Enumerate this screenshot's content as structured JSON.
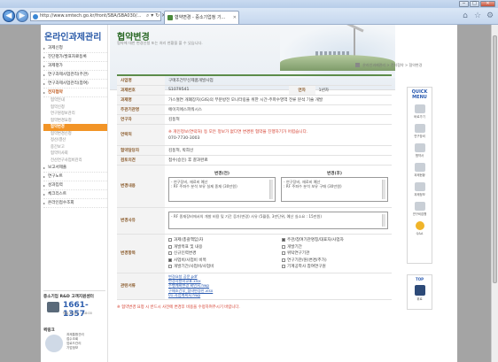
{
  "browser": {
    "address": "http://www.smtech.go.kr/front/SBA/SBA030/...",
    "tab_title": "협약변경 - 중소기업청 기...",
    "window_buttons": [
      "─",
      "□",
      "✕"
    ]
  },
  "sidebar": {
    "title": "온라인과제관리",
    "items": [
      {
        "label": "과제신청"
      },
      {
        "label": "진단평가/발표자료등록"
      },
      {
        "label": "과제평가"
      },
      {
        "label": "연구과제사업관리(주관)"
      },
      {
        "label": "연구과제사업관리(참여)"
      },
      {
        "label": "전자협약"
      }
    ],
    "sub_items": [
      "협약안내",
      "협약신청",
      "연구원정보관리",
      "협약변경요청",
      "협약변경",
      "협약변경신청",
      "정산/결산",
      "중간보고",
      "협약이사회",
      "전산연구사업비관리"
    ],
    "items_after": [
      {
        "label": "보고서제출"
      },
      {
        "label": "연구노트"
      },
      {
        "label": "성과입력"
      },
      {
        "label": "체크리스트"
      },
      {
        "label": "온라인접수조회"
      }
    ],
    "contact_head": "중소기업 R&D 고객지원센터",
    "contact_number": "1661-1357",
    "contact_hours": "평일 09:00 ~ 18:00",
    "links_head": "퀵링크",
    "links": [
      "과제통합관리",
      "접수조회",
      "업로드관리",
      "기업정보"
    ]
  },
  "header": {
    "title": "협약변경",
    "description": "협약에 대한 변경신청 또는 처리 현황을 볼 수 있습니다.",
    "breadcrumb": "온라인과제관리 > 전자협약 > 협약변경"
  },
  "form": {
    "project_name_label": "사업명",
    "project_name": "구매조건부신제품개발사업",
    "project_no_label": "과제번호",
    "project_no": "S1079541",
    "year_label": "연차",
    "year": "1년차",
    "task_name_label": "과제명",
    "task_name": "가스절연 개폐장치(GIS)의 부분방전 모니터링을 위한 시간-주파수영역 전류 분석 기술 개발",
    "lead_org_label": "주관기관명",
    "lead_org": "에이치에스파워시스",
    "researcher_label": "연구자",
    "researcher": "김동혁",
    "contact_label": "연락처",
    "contact_note": "※ 개인정보(연락처) 등 모든 정보가 없다면 변경된 협약을 진행하기가 어렵습니다.",
    "contact_phone": "070-7730-3003",
    "manager_label": "협약담당자",
    "manager": "김동혁, 박희선",
    "review_label": "검토의견",
    "review": "접수(승인) 후 결과완료",
    "change_content_label": "변경내용",
    "before_label": "변경(전)",
    "after_label": "변경(후)",
    "before_text": "- 연구장비, 재료비 예산\n: RF 주파수 분석 보유 실제 종재 (30만원)",
    "after_text": "- 연구장비, 재료비 예산\n: RF 주파수 분석 보유 구매 (30만원)",
    "reason_label": "변경사유",
    "reason_text": "- RF 종재장비에서의 개발 비용 및 기간 증가(변경) 사유 (5월중, 3만단위, 예산 실소요 : 15만원)",
    "items_label": "변경항목",
    "items": [
      {
        "label": "과제(총괄책임)자",
        "checked": false
      },
      {
        "label": "주관/참여기관명칭/대표자/사업자",
        "checked": true
      },
      {
        "label": "개발목표 및 내용",
        "checked": false
      },
      {
        "label": "개발기간",
        "checked": false
      },
      {
        "label": "신규인력변경",
        "checked": false
      },
      {
        "label": "위탁연구기관",
        "checked": false
      },
      {
        "label": "사업비/사업비 비목",
        "checked": true
      },
      {
        "label": "연구기관/원(변경/추가)",
        "checked": false
      },
      {
        "label": "개발기간/사업비/사업비",
        "checked": false
      },
      {
        "label": "기계공학사 참여연구원",
        "checked": false
      }
    ],
    "attach_label": "관련서류",
    "attachments": [
      "변경요청 공문.pdf",
      "변경사항비교표.xlsx",
      "수행계획변경 확인서.hwp",
      "구매조건부_협약변경안.xlsx",
      "01-사업계획서.hwp"
    ],
    "footnote": "※ 협약변경 요청 시 반드시 사전에 변경후 비용을 수정하여주시기 바랍니다."
  },
  "quick_menu": {
    "title": "QUICK MENU",
    "items": [
      "바로가기",
      "연구장비",
      "협약서",
      "과제현황",
      "과제정보",
      "연구비집행",
      "Q&A"
    ],
    "top_title": "TOP",
    "top_label": "위로"
  }
}
